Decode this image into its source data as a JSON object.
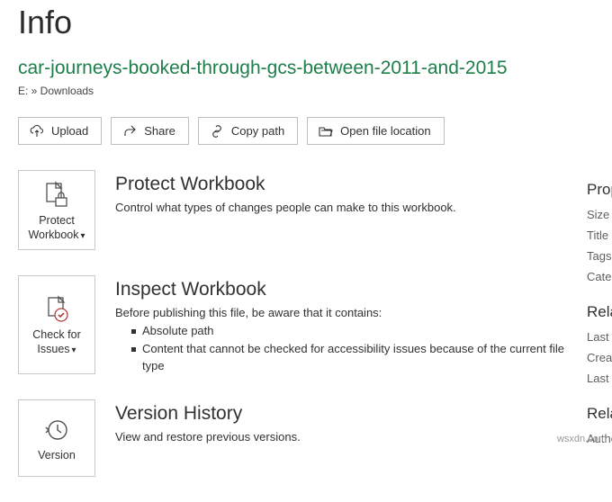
{
  "page": {
    "title": "Info"
  },
  "file": {
    "name": "car-journeys-booked-through-gcs-between-2011-and-2015",
    "breadcrumb": "E: » Downloads"
  },
  "toolbar": {
    "upload": "Upload",
    "share": "Share",
    "copy_path": "Copy path",
    "open_location": "Open file location"
  },
  "protect": {
    "button_l1": "Protect",
    "button_l2": "Workbook",
    "title": "Protect Workbook",
    "desc": "Control what types of changes people can make to this workbook."
  },
  "inspect": {
    "button_l1": "Check for",
    "button_l2": "Issues",
    "title": "Inspect Workbook",
    "desc": "Before publishing this file, be aware that it contains:",
    "items": [
      "Absolute path",
      "Content that cannot be checked for accessibility issues because of the current file type"
    ]
  },
  "version": {
    "button_l1": "Version",
    "title": "Version History",
    "desc": "View and restore previous versions."
  },
  "props": {
    "heading1": "Properties",
    "rows1": [
      "Size",
      "Title",
      "Tags",
      "Categories"
    ],
    "heading2": "Related Dates",
    "rows2": [
      "Last Modified",
      "Created",
      "Last Printed"
    ],
    "heading3": "Related People",
    "rows3": [
      "Author"
    ]
  },
  "watermark": "wsxdn.com"
}
